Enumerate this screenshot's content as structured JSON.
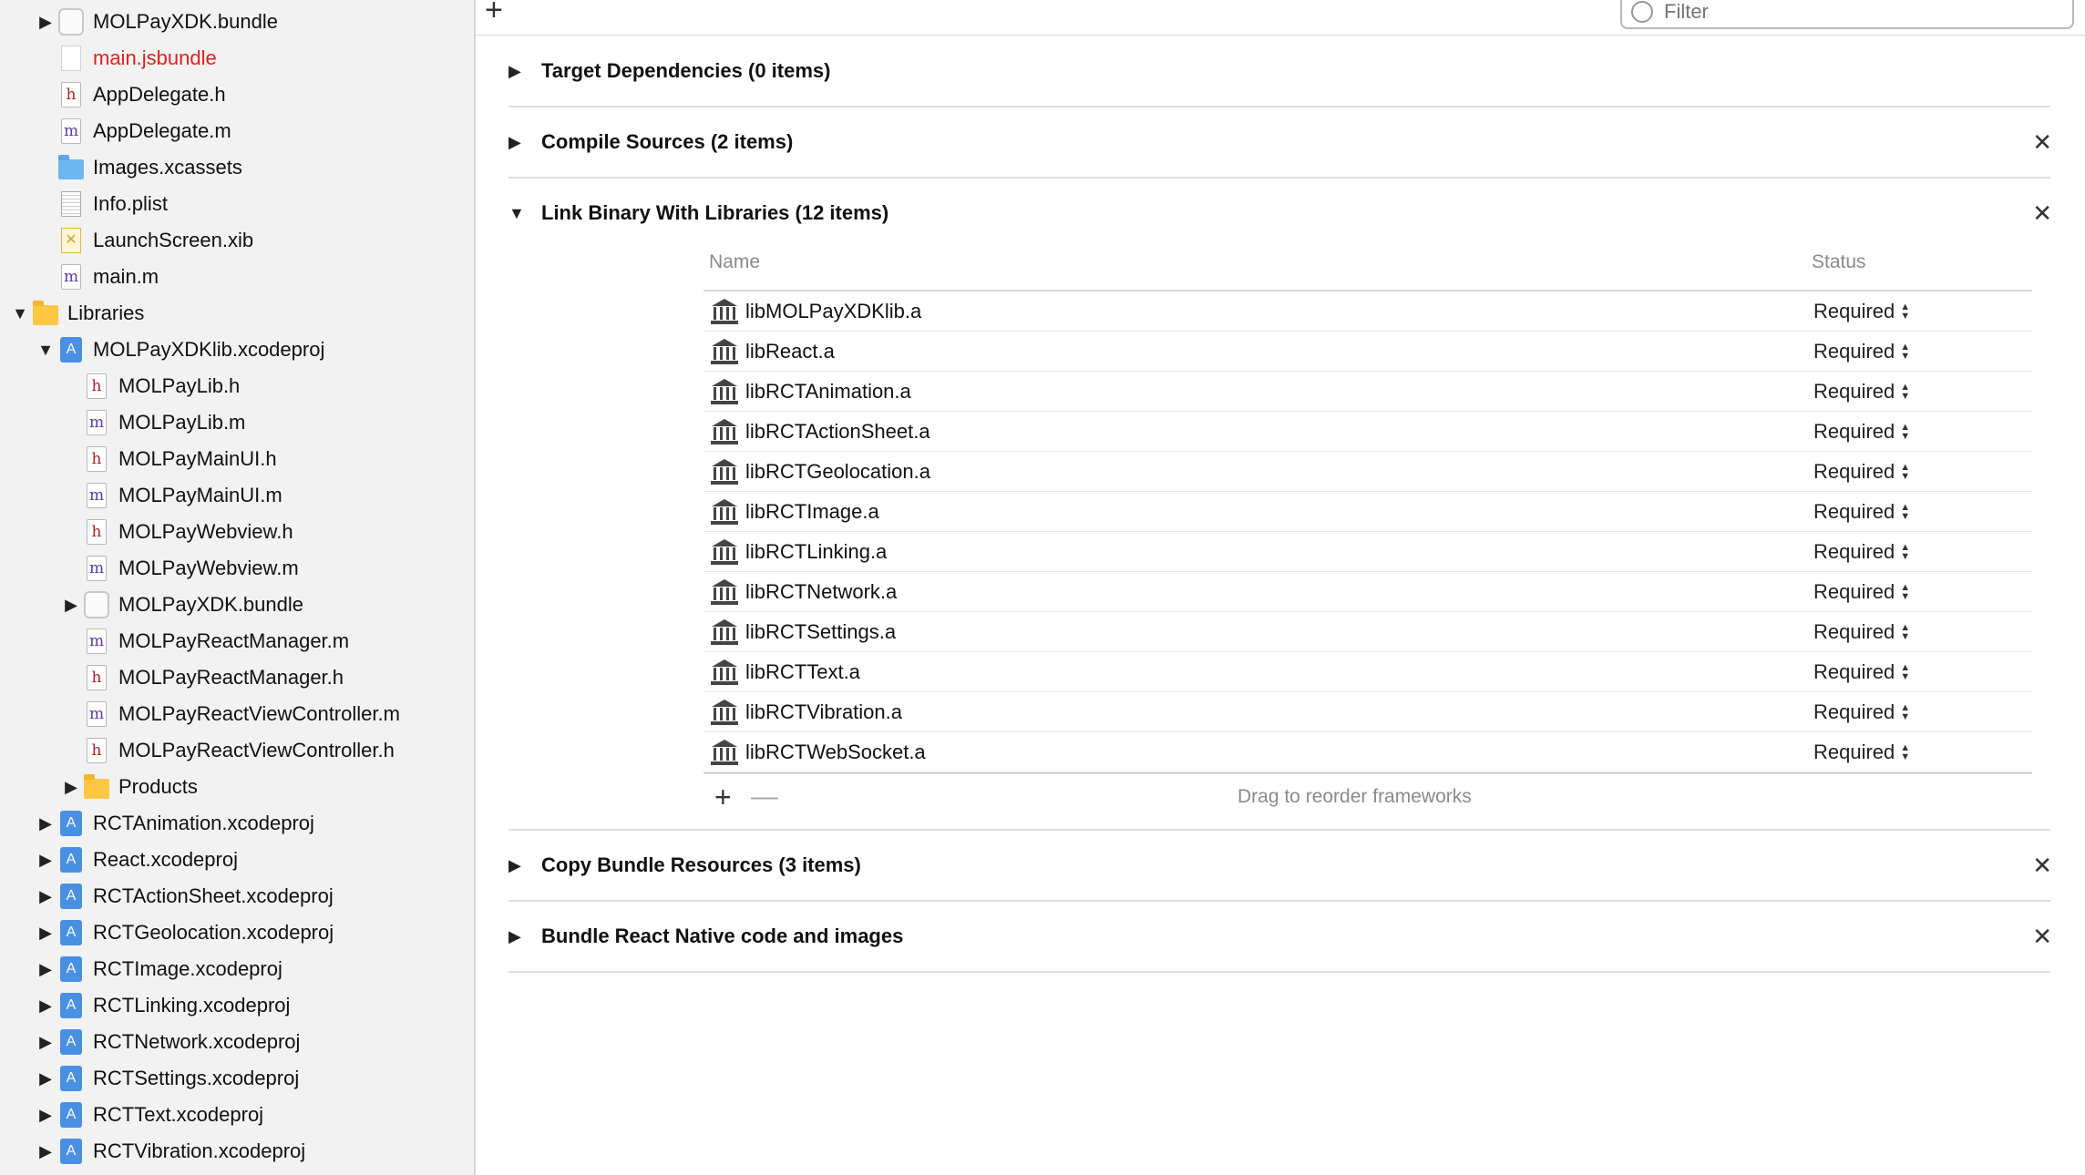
{
  "navigator": {
    "items": [
      {
        "label": "MOLPayXDK.bundle",
        "icon": "bundle-icon",
        "level": 2,
        "disclosure": "collapsed"
      },
      {
        "label": "main.jsbundle",
        "icon": "blank-file-icon",
        "level": 2,
        "disclosure": "none",
        "red": true
      },
      {
        "label": "AppDelegate.h",
        "icon": "header-file-icon",
        "level": 2,
        "disclosure": "none"
      },
      {
        "label": "AppDelegate.m",
        "icon": "objc-file-icon",
        "level": 2,
        "disclosure": "none"
      },
      {
        "label": "Images.xcassets",
        "icon": "asset-catalog-icon",
        "level": 2,
        "disclosure": "none"
      },
      {
        "label": "Info.plist",
        "icon": "plist-file-icon",
        "level": 2,
        "disclosure": "none"
      },
      {
        "label": "LaunchScreen.xib",
        "icon": "xib-file-icon",
        "level": 2,
        "disclosure": "none"
      },
      {
        "label": "main.m",
        "icon": "objc-file-icon",
        "level": 2,
        "disclosure": "none"
      },
      {
        "label": "Libraries",
        "icon": "folder-icon",
        "level": 1,
        "disclosure": "expanded"
      },
      {
        "label": "MOLPayXDKlib.xcodeproj",
        "icon": "xcodeproj-icon",
        "level": 2,
        "disclosure": "expanded"
      },
      {
        "label": "MOLPayLib.h",
        "icon": "header-file-icon",
        "level": 3,
        "disclosure": "none"
      },
      {
        "label": "MOLPayLib.m",
        "icon": "objc-file-icon",
        "level": 3,
        "disclosure": "none"
      },
      {
        "label": "MOLPayMainUI.h",
        "icon": "header-file-icon",
        "level": 3,
        "disclosure": "none"
      },
      {
        "label": "MOLPayMainUI.m",
        "icon": "objc-file-icon",
        "level": 3,
        "disclosure": "none"
      },
      {
        "label": "MOLPayWebview.h",
        "icon": "header-file-icon",
        "level": 3,
        "disclosure": "none"
      },
      {
        "label": "MOLPayWebview.m",
        "icon": "objc-file-icon",
        "level": 3,
        "disclosure": "none"
      },
      {
        "label": "MOLPayXDK.bundle",
        "icon": "bundle-icon",
        "level": 3,
        "disclosure": "collapsed"
      },
      {
        "label": "MOLPayReactManager.m",
        "icon": "objc-file-icon",
        "level": 3,
        "disclosure": "none"
      },
      {
        "label": "MOLPayReactManager.h",
        "icon": "header-file-icon",
        "level": 3,
        "disclosure": "none"
      },
      {
        "label": "MOLPayReactViewController.m",
        "icon": "objc-file-icon",
        "level": 3,
        "disclosure": "none"
      },
      {
        "label": "MOLPayReactViewController.h",
        "icon": "header-file-icon",
        "level": 3,
        "disclosure": "none"
      },
      {
        "label": "Products",
        "icon": "folder-icon",
        "level": 3,
        "disclosure": "collapsed"
      },
      {
        "label": "RCTAnimation.xcodeproj",
        "icon": "xcodeproj-icon",
        "level": 2,
        "disclosure": "collapsed"
      },
      {
        "label": "React.xcodeproj",
        "icon": "xcodeproj-icon",
        "level": 2,
        "disclosure": "collapsed"
      },
      {
        "label": "RCTActionSheet.xcodeproj",
        "icon": "xcodeproj-icon",
        "level": 2,
        "disclosure": "collapsed"
      },
      {
        "label": "RCTGeolocation.xcodeproj",
        "icon": "xcodeproj-icon",
        "level": 2,
        "disclosure": "collapsed"
      },
      {
        "label": "RCTImage.xcodeproj",
        "icon": "xcodeproj-icon",
        "level": 2,
        "disclosure": "collapsed"
      },
      {
        "label": "RCTLinking.xcodeproj",
        "icon": "xcodeproj-icon",
        "level": 2,
        "disclosure": "collapsed"
      },
      {
        "label": "RCTNetwork.xcodeproj",
        "icon": "xcodeproj-icon",
        "level": 2,
        "disclosure": "collapsed"
      },
      {
        "label": "RCTSettings.xcodeproj",
        "icon": "xcodeproj-icon",
        "level": 2,
        "disclosure": "collapsed"
      },
      {
        "label": "RCTText.xcodeproj",
        "icon": "xcodeproj-icon",
        "level": 2,
        "disclosure": "collapsed"
      },
      {
        "label": "RCTVibration.xcodeproj",
        "icon": "xcodeproj-icon",
        "level": 2,
        "disclosure": "collapsed"
      }
    ]
  },
  "toolbar": {
    "add_icon": "plus-icon",
    "filter_placeholder": "Filter"
  },
  "phases": {
    "target_dependencies": {
      "title": "Target Dependencies (0 items)",
      "expanded": false,
      "removable": false
    },
    "compile_sources": {
      "title": "Compile Sources (2 items)",
      "expanded": false,
      "removable": true
    },
    "link_binary": {
      "title": "Link Binary With Libraries (12 items)",
      "expanded": true,
      "removable": true
    },
    "copy_bundle": {
      "title": "Copy Bundle Resources (3 items)",
      "expanded": false,
      "removable": true
    },
    "bundle_react": {
      "title": "Bundle React Native code and images",
      "expanded": false,
      "removable": true
    }
  },
  "libraries": {
    "columns": {
      "name": "Name",
      "status": "Status"
    },
    "rows": [
      {
        "name": "libMOLPayXDKlib.a",
        "status": "Required"
      },
      {
        "name": "libReact.a",
        "status": "Required"
      },
      {
        "name": "libRCTAnimation.a",
        "status": "Required"
      },
      {
        "name": "libRCTActionSheet.a",
        "status": "Required"
      },
      {
        "name": "libRCTGeolocation.a",
        "status": "Required"
      },
      {
        "name": "libRCTImage.a",
        "status": "Required"
      },
      {
        "name": "libRCTLinking.a",
        "status": "Required"
      },
      {
        "name": "libRCTNetwork.a",
        "status": "Required"
      },
      {
        "name": "libRCTSettings.a",
        "status": "Required"
      },
      {
        "name": "libRCTText.a",
        "status": "Required"
      },
      {
        "name": "libRCTVibration.a",
        "status": "Required"
      },
      {
        "name": "libRCTWebSocket.a",
        "status": "Required"
      }
    ],
    "footer_hint": "Drag to reorder frameworks"
  }
}
